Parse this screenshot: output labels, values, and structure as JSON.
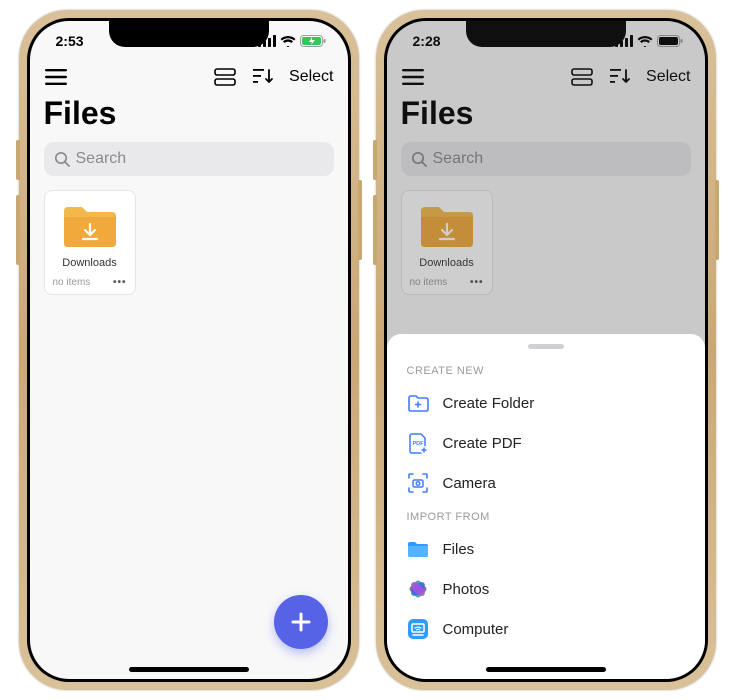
{
  "left": {
    "status_time": "2:53",
    "battery_charging": true,
    "toolbar": {
      "select_label": "Select"
    },
    "title": "Files",
    "search_placeholder": "Search",
    "folder": {
      "name": "Downloads",
      "count_label": "no items"
    }
  },
  "right": {
    "status_time": "2:28",
    "battery_charging": false,
    "toolbar": {
      "select_label": "Select"
    },
    "title": "Files",
    "search_placeholder": "Search",
    "folder": {
      "name": "Downloads",
      "count_label": "no items"
    },
    "sheet": {
      "create_header": "CREATE NEW",
      "create_items": [
        {
          "label": "Create Folder",
          "icon": "folder-plus"
        },
        {
          "label": "Create PDF",
          "icon": "pdf-plus"
        },
        {
          "label": "Camera",
          "icon": "camera-scan"
        }
      ],
      "import_header": "IMPORT FROM",
      "import_items": [
        {
          "label": "Files",
          "icon": "files-app"
        },
        {
          "label": "Photos",
          "icon": "photos-app"
        },
        {
          "label": "Computer",
          "icon": "computer"
        }
      ]
    }
  }
}
